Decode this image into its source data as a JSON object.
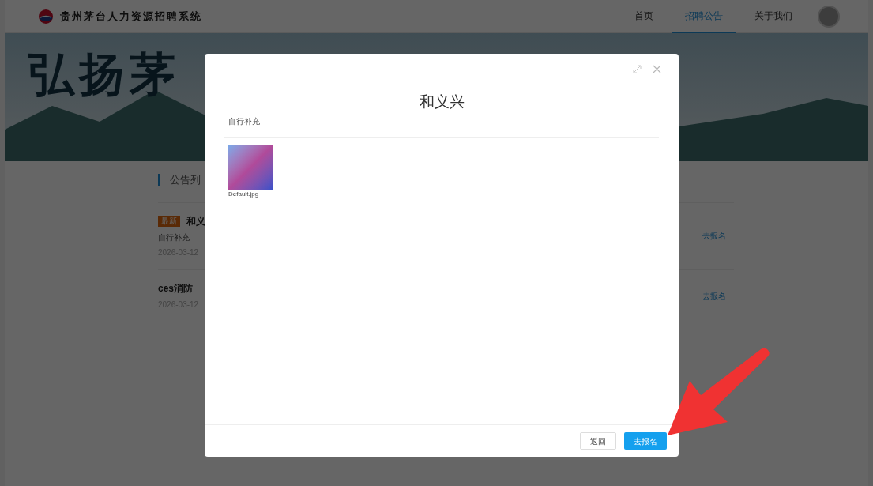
{
  "header": {
    "title": "贵州茅台人力资源招聘系统",
    "nav": [
      {
        "label": "首页",
        "selected": false
      },
      {
        "label": "招聘公告",
        "selected": true
      },
      {
        "label": "关于我们",
        "selected": false
      }
    ]
  },
  "banner": {
    "lines": [
      "弘扬茅"
    ]
  },
  "list": {
    "heading": "公告列",
    "items": [
      {
        "badge": "最新",
        "title": "和义",
        "subtitle": "自行补充",
        "date": "2026-03-12",
        "action": "去报名"
      },
      {
        "title": "ces消防",
        "date": "2026-03-12",
        "action": "去报名"
      }
    ]
  },
  "modal": {
    "title": "和义兴",
    "subtitle": "自行补充",
    "attachments": [
      {
        "filename": "Default.jpg"
      }
    ],
    "buttons": [
      {
        "label": "返回",
        "kind": "default"
      },
      {
        "label": "去报名",
        "kind": "primary"
      }
    ]
  }
}
